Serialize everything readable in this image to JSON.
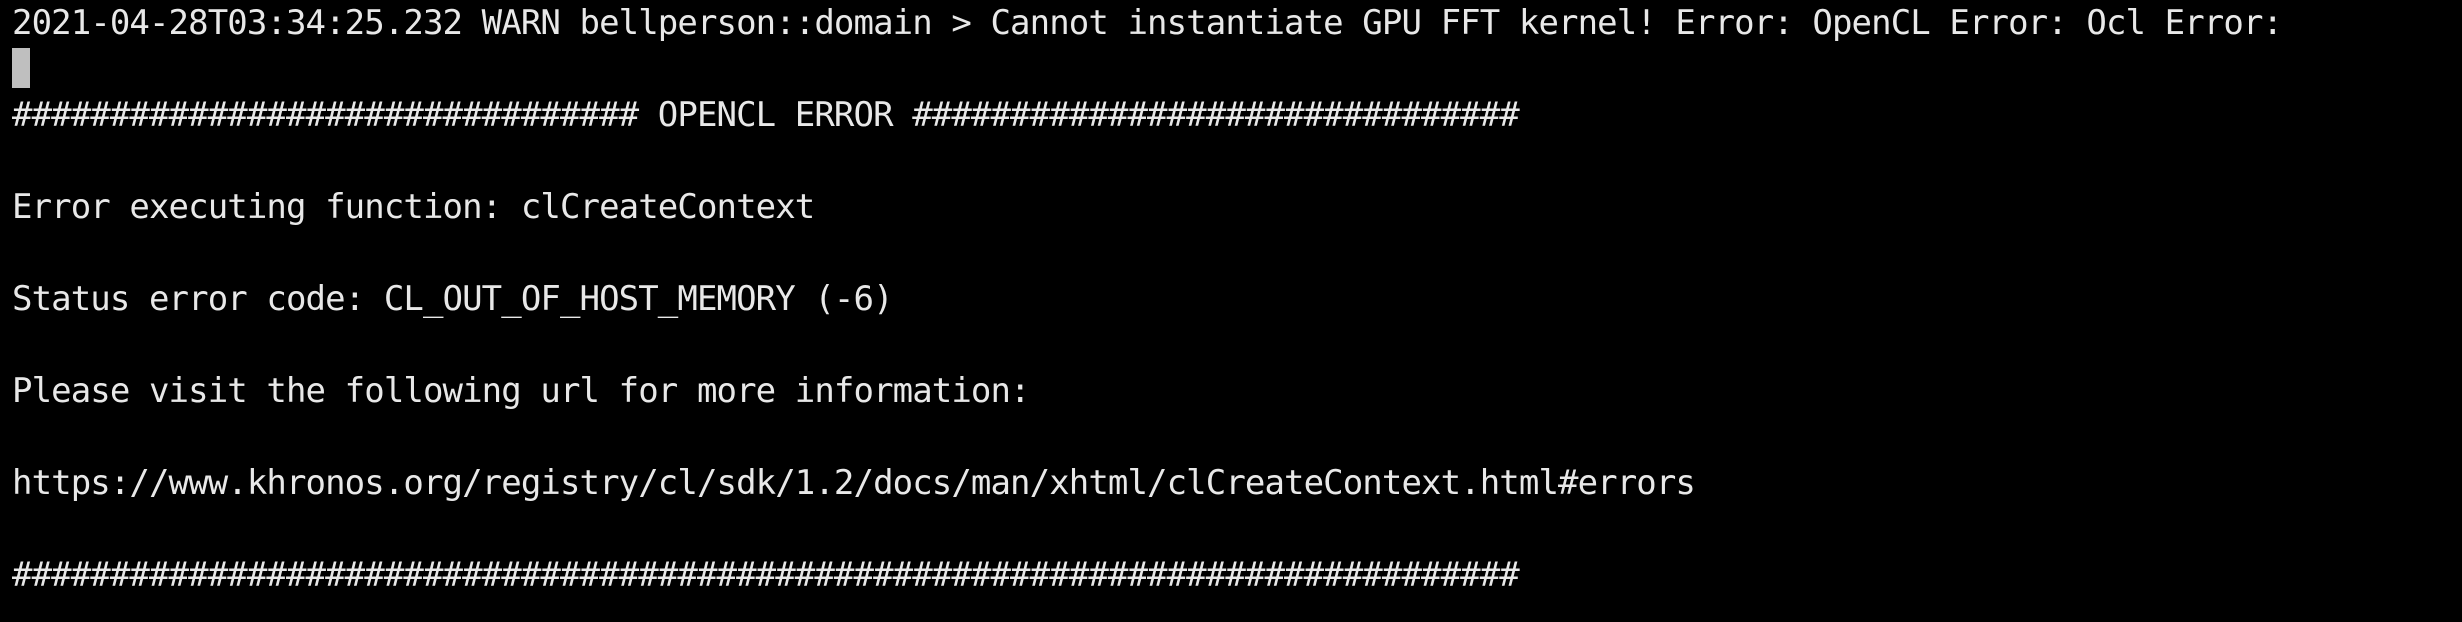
{
  "terminal": {
    "lines": {
      "warn": "2021-04-28T03:34:25.232 WARN bellperson::domain > Cannot instantiate GPU FFT kernel! Error: OpenCL Error: Ocl Error:",
      "banner_top": "################################ OPENCL ERROR ###############################",
      "function": "Error executing function: clCreateContext",
      "status": "Status error code: CL_OUT_OF_HOST_MEMORY (-6)",
      "visit": "Please visit the following url for more information:",
      "url": "https://www.khronos.org/registry/cl/sdk/1.2/docs/man/xhtml/clCreateContext.html#errors",
      "banner_bottom": "#############################################################################"
    }
  },
  "colors": {
    "background": "#000000",
    "text": "#e8e8e8",
    "cursor": "#bfbfbf"
  }
}
